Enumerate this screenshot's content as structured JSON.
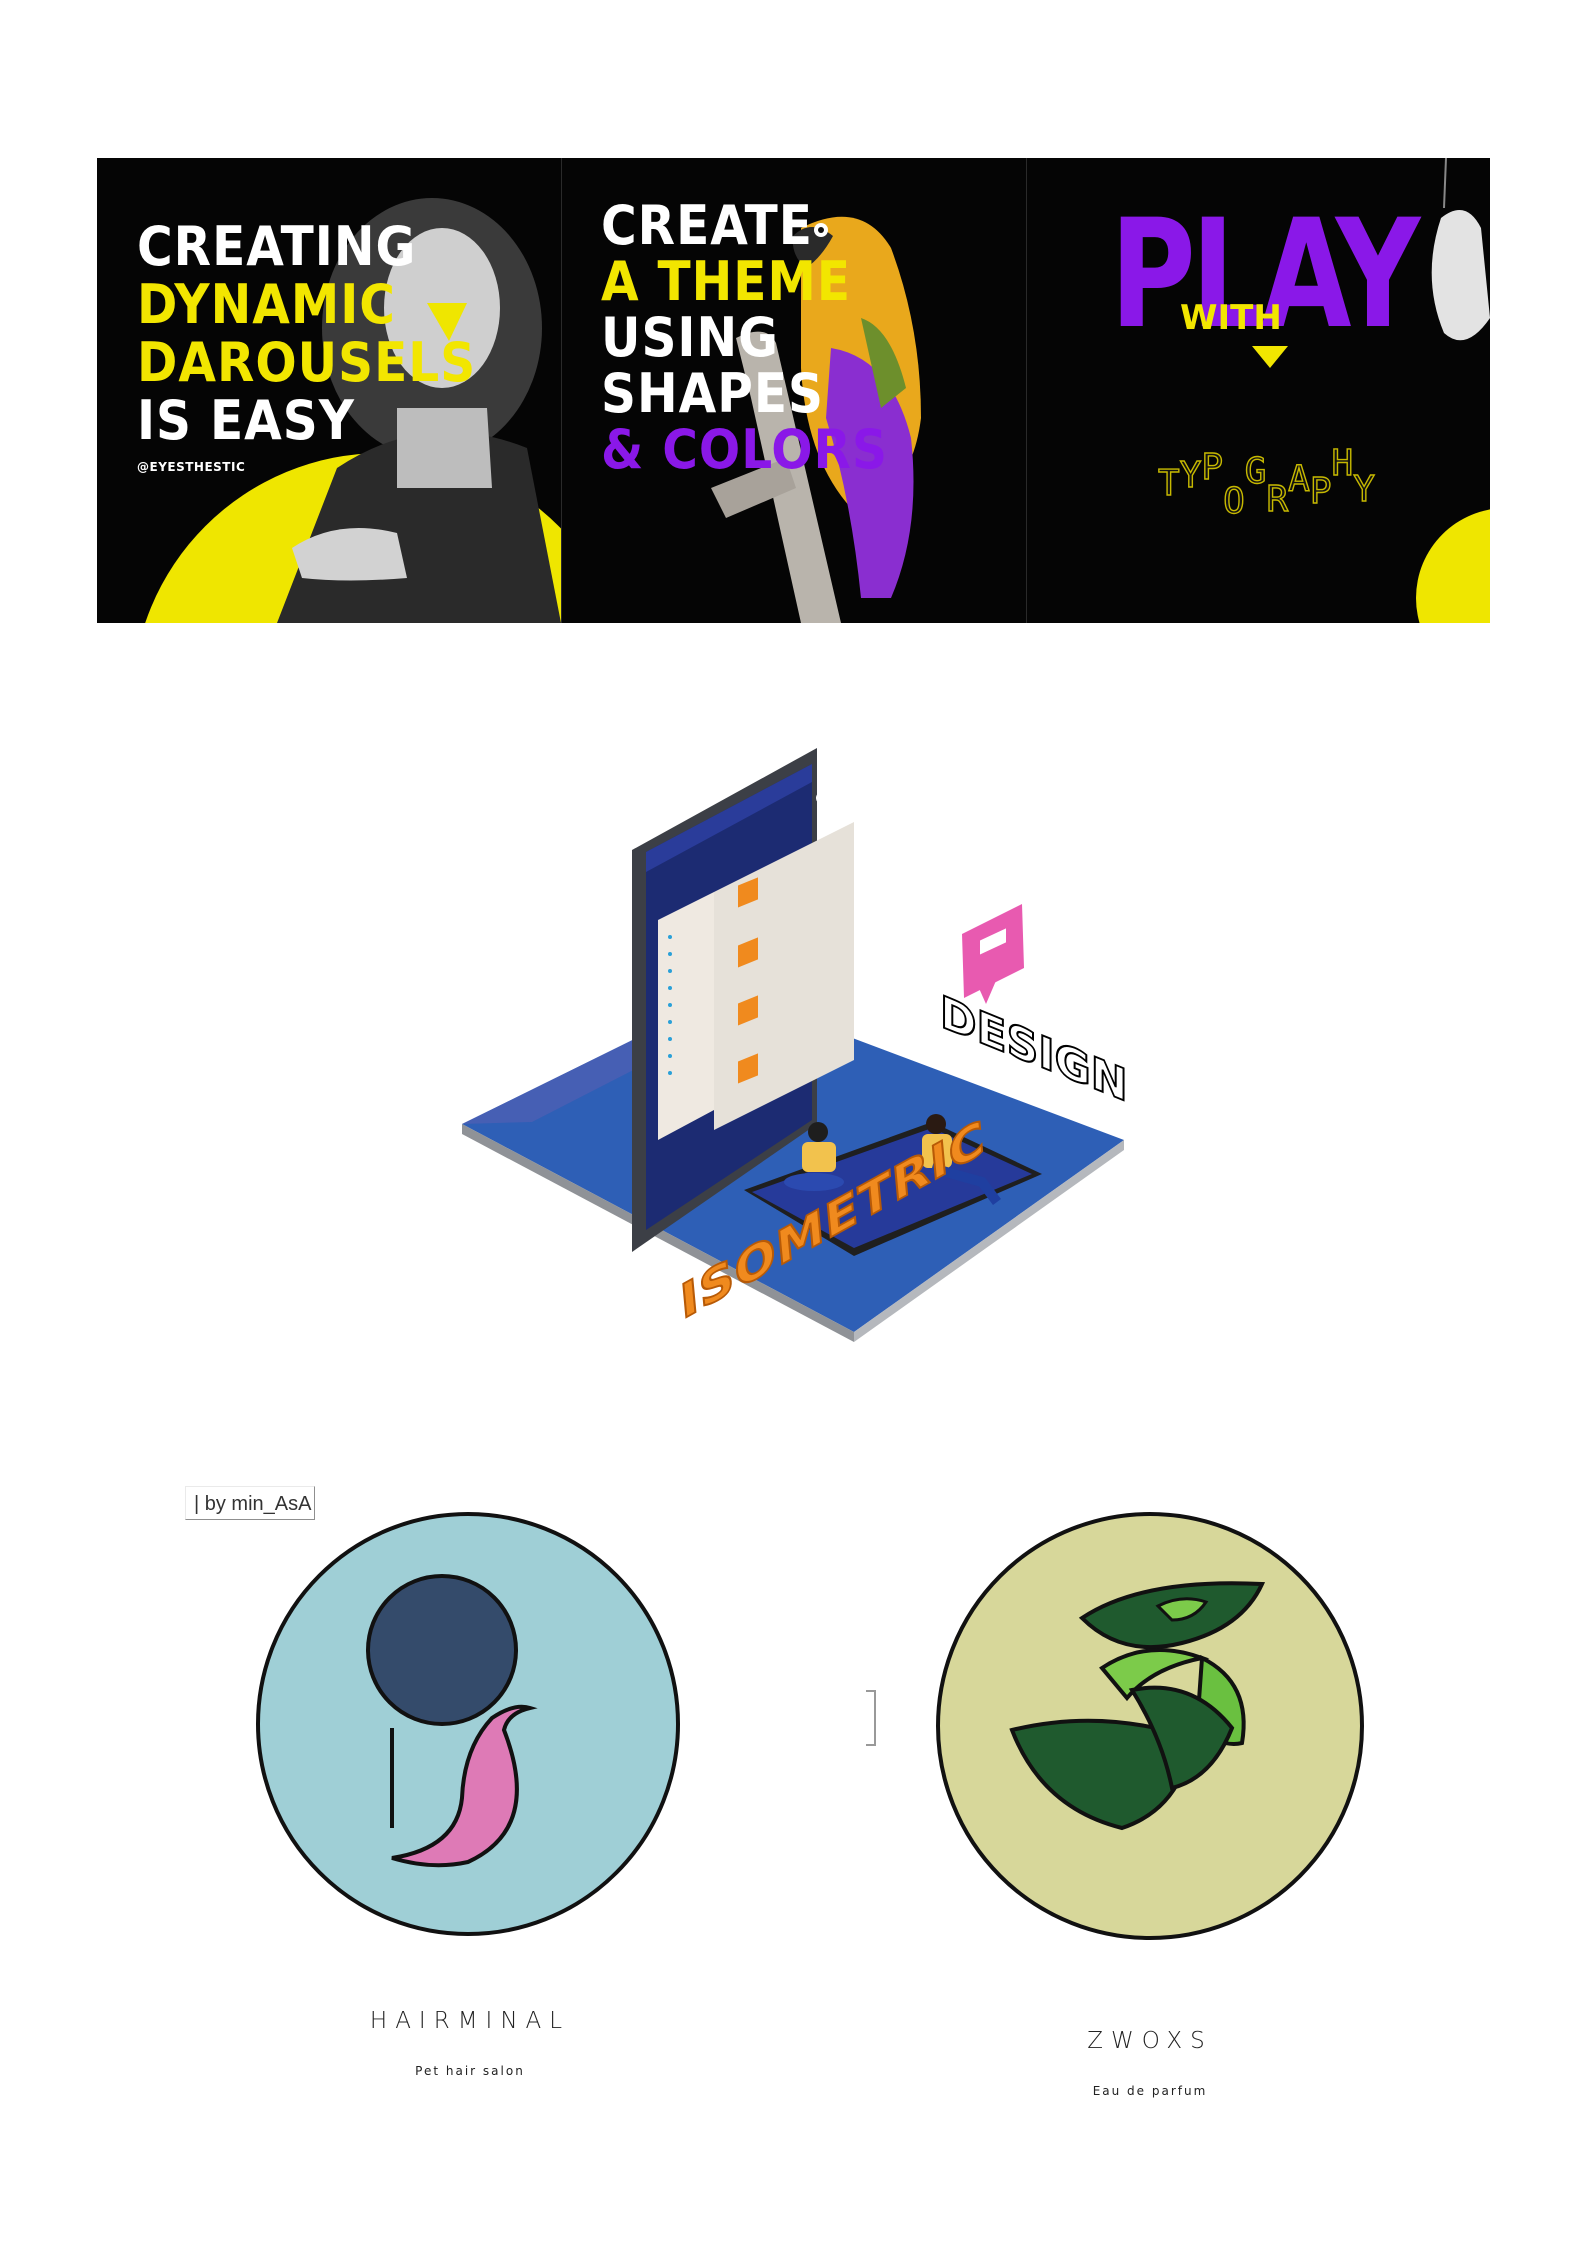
{
  "banner": {
    "panel1_lines": [
      "CREATING",
      "DYNAMIC",
      "DAROUSELS",
      "IS EASY"
    ],
    "handle": "@EYESTHESTIC",
    "panel2_lines": [
      "CREATE",
      "A THEME",
      "USING",
      "SHAPES",
      "& COLORS"
    ],
    "panel3_big": "PLAY",
    "panel3_with": "WITH",
    "panel3_typography": [
      "T",
      "Y",
      "P",
      "O",
      "G",
      "R",
      "A",
      "P",
      "H",
      "Y"
    ]
  },
  "isometric": {
    "word1": "ISOMETRIC",
    "word2": "DESIGN"
  },
  "logos": {
    "credit_tag": "| by min_AsA",
    "left_name": "HAIRMINAL",
    "left_sub": "Pet hair salon",
    "right_name": "ZWOXS",
    "right_sub": "Eau de parfum"
  },
  "colors": {
    "yellow": "#f2e600",
    "purple": "#8a18e8",
    "banner_bg": "#050505",
    "hair_circle": "#9fcfd6",
    "zwoxs_circle": "#d7d79a"
  }
}
